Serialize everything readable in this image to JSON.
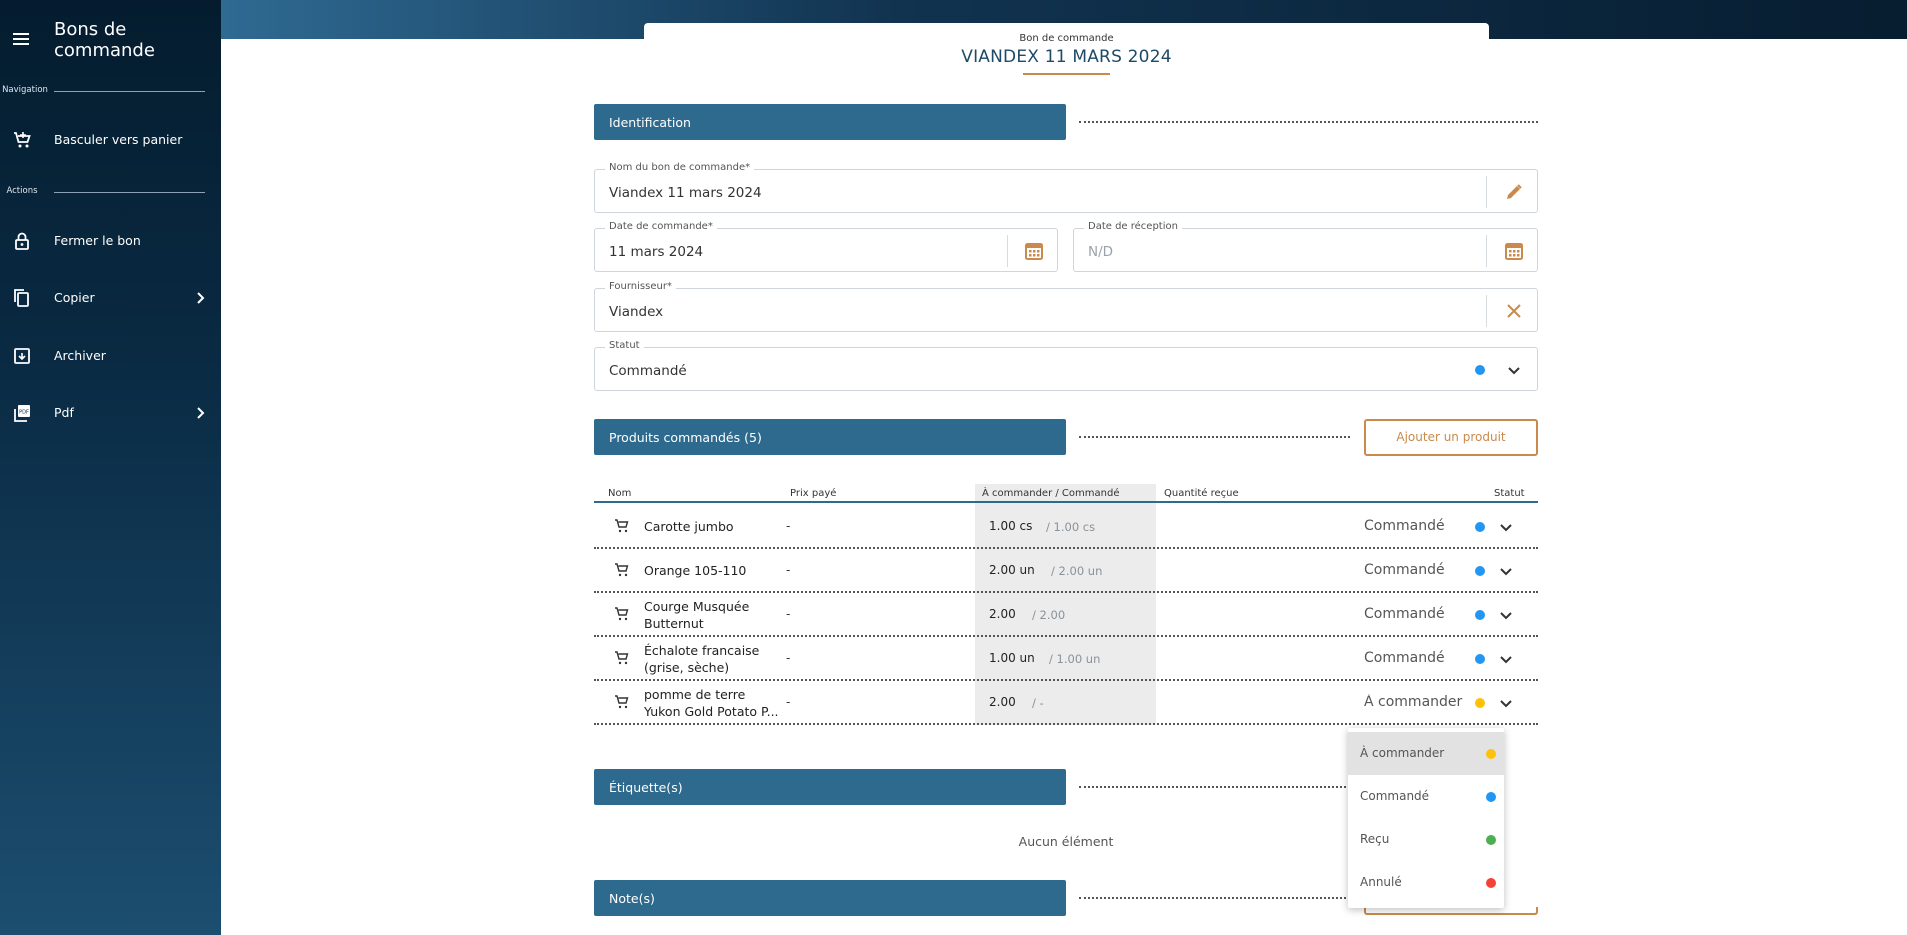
{
  "sidebar": {
    "title": "Bons de commande",
    "section_navigation": "Navigation",
    "section_actions": "Actions",
    "items": [
      {
        "label": "Basculer vers panier",
        "icon": "cart-plus-icon"
      },
      {
        "label": "Fermer le bon",
        "icon": "lock-icon"
      },
      {
        "label": "Copier",
        "icon": "copy-icon"
      },
      {
        "label": "Archiver",
        "icon": "archive-icon"
      },
      {
        "label": "Pdf",
        "icon": "pdf-icon"
      }
    ]
  },
  "header": {
    "subtitle": "Bon de commande",
    "title": "VIANDEX 11 MARS 2024"
  },
  "identification": {
    "section_label": "Identification",
    "name_label": "Nom du bon de commande*",
    "name_value": "Viandex 11 mars 2024",
    "order_date_label": "Date de commande*",
    "order_date_value": "11 mars 2024",
    "reception_date_label": "Date de réception",
    "reception_date_placeholder": "N/D",
    "supplier_label": "Fournisseur*",
    "supplier_value": "Viandex",
    "status_label": "Statut",
    "status_value": "Commandé"
  },
  "products": {
    "section_label": "Produits commandés (5)",
    "add_button": "Ajouter un produit",
    "columns": {
      "name": "Nom",
      "price": "Prix payé",
      "order": "À commander / Commandé",
      "received": "Quantité  reçue",
      "status": "Statut"
    },
    "rows": [
      {
        "name": "Carotte jumbo",
        "price": "-",
        "qty": "1.00 cs",
        "ordered": "/ 1.00 cs",
        "status": "Commandé",
        "status_color": "#2196f3"
      },
      {
        "name": "Orange 105-110",
        "price": "-",
        "qty": "2.00 un",
        "ordered": "/ 2.00 un",
        "status": "Commandé",
        "status_color": "#2196f3"
      },
      {
        "name": "Courge Musquée Butternut",
        "price": "-",
        "qty": "2.00",
        "ordered": "/ 2.00",
        "status": "Commandé",
        "status_color": "#2196f3"
      },
      {
        "name": "Échalote francaise (grise, sèche)",
        "price": "-",
        "qty": "1.00 un",
        "ordered": "/ 1.00 un",
        "status": "Commandé",
        "status_color": "#2196f3"
      },
      {
        "name": "pomme de terre Yukon Gold Potato P...",
        "price": "-",
        "qty": "2.00",
        "ordered": "/  -",
        "status": "À commander",
        "status_color": "#ffc107"
      }
    ]
  },
  "labels": {
    "section_label": "Étiquette(s)",
    "empty_text": "Aucun élément"
  },
  "notes": {
    "section_label": "Note(s)"
  },
  "status_dropdown": {
    "options": [
      {
        "label": "À commander",
        "color": "#ffc107"
      },
      {
        "label": "Commandé",
        "color": "#2196f3"
      },
      {
        "label": "Reçu",
        "color": "#4caf50"
      },
      {
        "label": "Annulé",
        "color": "#f44336"
      }
    ]
  },
  "colors": {
    "accent": "#c98a4c",
    "section_bar": "#2e6a8e",
    "sidebar": "#0a2b44"
  }
}
